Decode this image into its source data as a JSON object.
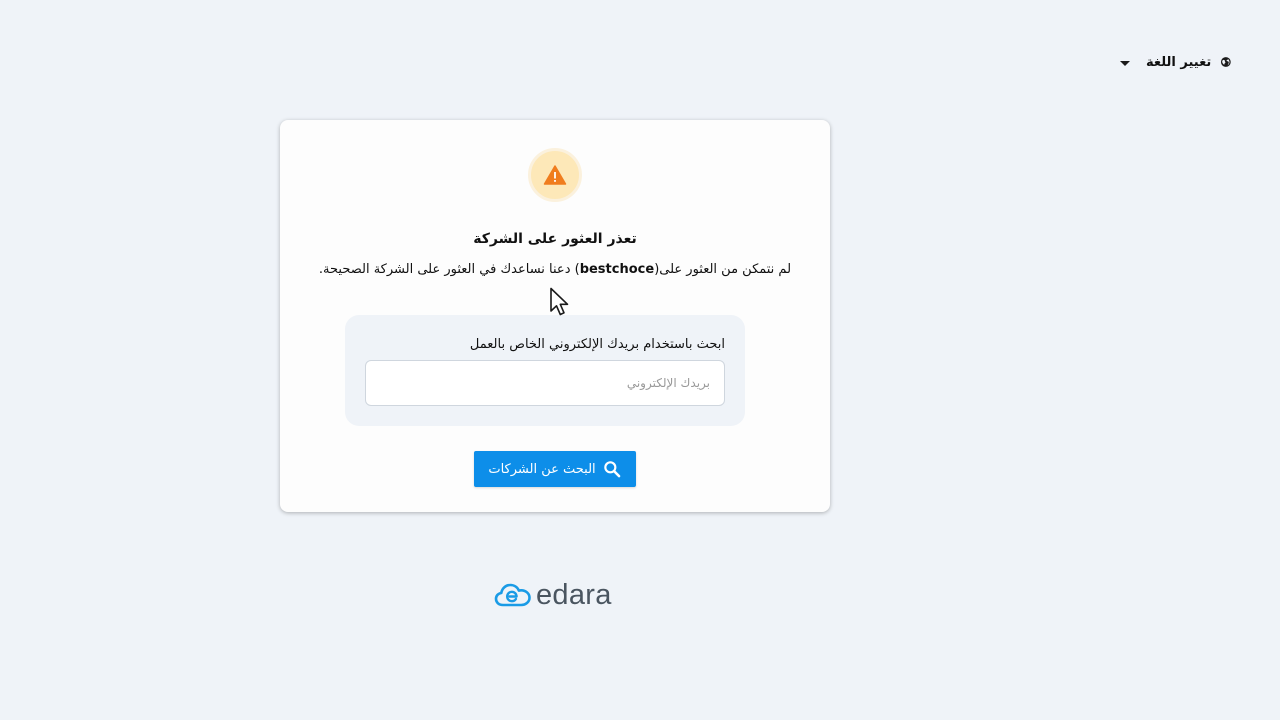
{
  "language_switcher": {
    "label": "تغيير اللغة",
    "icon": "globe-icon"
  },
  "error_card": {
    "icon": "warning-icon",
    "title": "تعذر العثور على الشركة",
    "message_before": "لم نتمكن من العثور على(",
    "company": "bestchoce",
    "message_after": ") دعنا نساعدك في العثور على الشركة الصحيحة."
  },
  "search": {
    "label": "ابحث باستخدام بريدك الإلكتروني الخاص بالعمل",
    "email_value": "",
    "email_placeholder": "بريدك الإلكتروني",
    "button_label": "البحث عن الشركات",
    "button_icon": "search-icon"
  },
  "logo": {
    "text": "edara"
  },
  "colors": {
    "accent": "#0d8ee9",
    "warning": "#f07d1e",
    "warning_bg": "#fde8b8",
    "background": "#eff3f8",
    "logo_blue": "#1a9be6"
  }
}
